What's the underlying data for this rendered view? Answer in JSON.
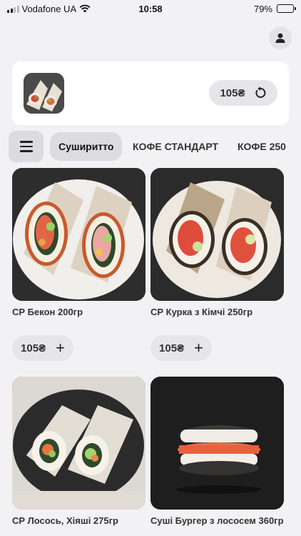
{
  "status_bar": {
    "carrier": "Vodafone UA",
    "time": "10:58",
    "battery": "79%",
    "battery_level": 0.79
  },
  "header": {
    "profile_icon": "user-icon"
  },
  "cart": {
    "price": "105₴",
    "repeat_icon": "refresh-icon"
  },
  "categories": {
    "menu_icon": "hamburger-icon",
    "tabs": [
      {
        "label": "Суширитто",
        "active": true
      },
      {
        "label": "КОФЕ СТАНДАРТ",
        "active": false
      },
      {
        "label": "КОФЕ 250",
        "active": false
      }
    ]
  },
  "products": [
    {
      "name": "СР Бекон 200гр",
      "price": "105₴"
    },
    {
      "name": "СР Курка з Кімчі 250гр",
      "price": "105₴"
    },
    {
      "name": "СР Лосось, Хіяші 275гр",
      "price": ""
    },
    {
      "name": "Суші Бургер з лососем 360гр",
      "price": ""
    }
  ],
  "colors": {
    "background": "#f2f2f4",
    "card": "#ffffff",
    "pill": "#e6e6ea",
    "active_tab": "#dcdce0"
  }
}
